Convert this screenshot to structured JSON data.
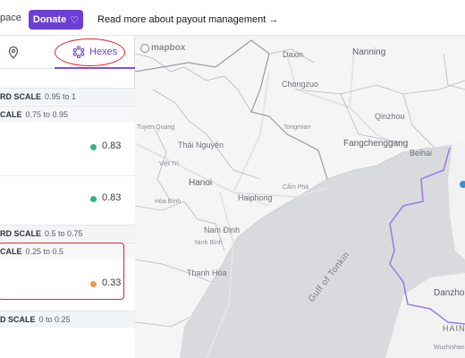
{
  "topbar": {
    "partial_text": "pace",
    "donate_label": "Donate",
    "readmore": "Read more about payout management →"
  },
  "sidebar": {
    "tabs": [
      {
        "icon": "location-pin-icon",
        "label": ""
      },
      {
        "icon": "hexagon-cluster-icon",
        "label": "Hexes"
      }
    ],
    "sections": [
      {
        "title": "RD SCALE",
        "range": "0.95 to 1"
      },
      {
        "title": "CALE",
        "range": "0.75 to 0.95"
      },
      {
        "title": "RD SCALE",
        "range": "0.5 to 0.75"
      },
      {
        "title": "CALE",
        "range": "0.25 to 0.5"
      },
      {
        "title": "D SCALE",
        "range": "0 to 0.25"
      }
    ],
    "rows": [
      {
        "value": "0.83",
        "color": "#2fb389"
      },
      {
        "value": "0.83",
        "color": "#2fb389"
      },
      {
        "value": "0.33",
        "color": "#f0954a"
      }
    ]
  },
  "map": {
    "attribution": "mapbox",
    "labels": {
      "daxin": "Daxin",
      "nanning": "Nanning",
      "chongzuo": "Chongzuo",
      "qinzhou": "Qinzhou",
      "tongmian": "Tongmian",
      "tuyen_quang": "Tuyen Quang",
      "thai_nguyen": "Thái Nguyên",
      "fangchenggang": "Fangchenggang",
      "beihai": "Beihai",
      "viet_tri": "Việt Trì",
      "hanoi": "Hanoi",
      "haiphong": "Haiphong",
      "cam_pha": "Cẩm Phả",
      "hoa_binh": "Hòa Bình",
      "nam_dinh": "Nam Định",
      "ninh_binh": "Ninh Bình",
      "thanh_hoa": "Thanh Hóa",
      "gulf": "Gulf of Tonkin",
      "danzhou": "Danzho",
      "hain": "HAIN",
      "wuzhishan": "Wuzhishan"
    }
  }
}
